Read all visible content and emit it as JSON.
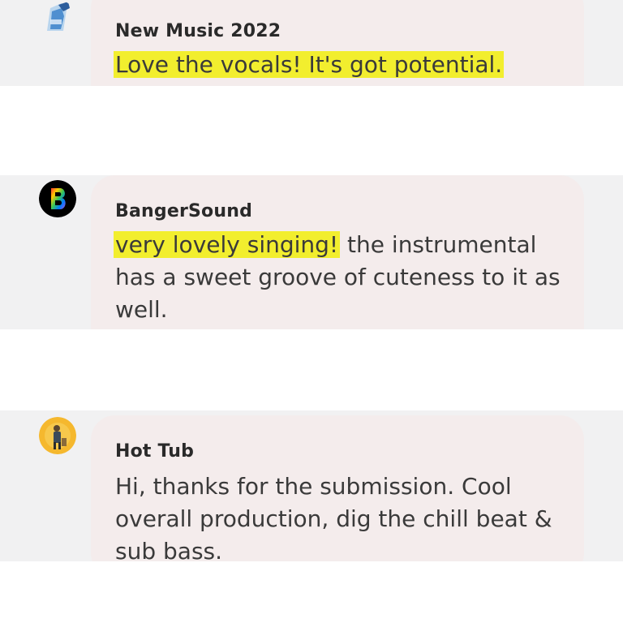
{
  "comments": [
    {
      "username": "New Music 2022",
      "message_highlighted": "Love the vocals! It's got potential.",
      "message_rest": "",
      "avatar_icon": "water-bottle-avatar-icon"
    },
    {
      "username": "BangerSound",
      "message_highlighted": "very lovely singing!",
      "message_rest": " the instrumental has a sweet groove of cuteness to it as well.",
      "avatar_icon": "letter-b-avatar-icon"
    },
    {
      "username": "Hot Tub",
      "message_highlighted": "",
      "message_rest": "Hi, thanks for the submission. Cool overall production, dig the chill beat & sub bass.",
      "avatar_icon": "person-photo-avatar-icon"
    }
  ],
  "colors": {
    "highlight": "#f2ee2e",
    "bubble": "#f4ecec",
    "strip": "#f1f1f2"
  }
}
